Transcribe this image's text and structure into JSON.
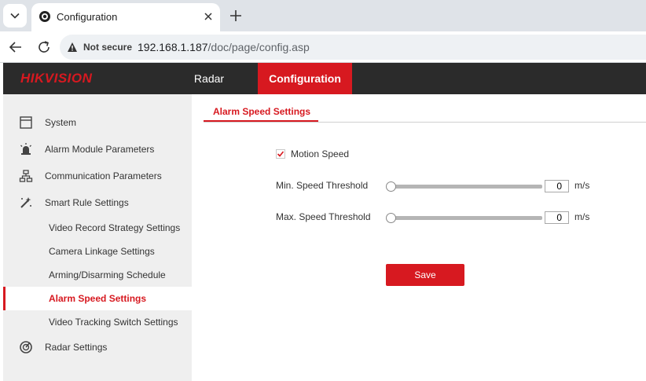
{
  "browser": {
    "tab_title": "Configuration",
    "not_secure": "Not secure",
    "url_host": "192.168.1.187",
    "url_path": "/doc/page/config.asp"
  },
  "header": {
    "logo": "HIKVISION",
    "nav": [
      {
        "label": "Radar"
      },
      {
        "label": "Configuration",
        "active": true
      }
    ]
  },
  "sidebar": {
    "items": [
      {
        "label": "System",
        "icon": "system-window-icon"
      },
      {
        "label": "Alarm Module Parameters",
        "icon": "alarm-siren-icon"
      },
      {
        "label": "Communication Parameters",
        "icon": "network-icon"
      },
      {
        "label": "Smart Rule Settings",
        "icon": "smart-rule-icon"
      },
      {
        "label": "Video Record Strategy Settings"
      },
      {
        "label": "Camera Linkage Settings"
      },
      {
        "label": "Arming/Disarming Schedule"
      },
      {
        "label": "Alarm Speed Settings",
        "active": true
      },
      {
        "label": "Video Tracking Switch Settings"
      },
      {
        "label": "Radar Settings",
        "icon": "radar-icon"
      }
    ]
  },
  "content": {
    "tab_label": "Alarm Speed Settings",
    "motion_speed": {
      "label": "Motion Speed",
      "checked": true
    },
    "min_speed": {
      "label": "Min. Speed Threshold",
      "value": "0",
      "unit": "m/s",
      "slider_level": 0
    },
    "max_speed": {
      "label": "Max. Speed Threshold",
      "value": "0",
      "unit": "m/s",
      "slider_level": 0
    },
    "save_label": "Save"
  },
  "colors": {
    "brand_red": "#d71920",
    "header_bg": "#2b2b2b",
    "sidebar_bg": "#efefef"
  }
}
